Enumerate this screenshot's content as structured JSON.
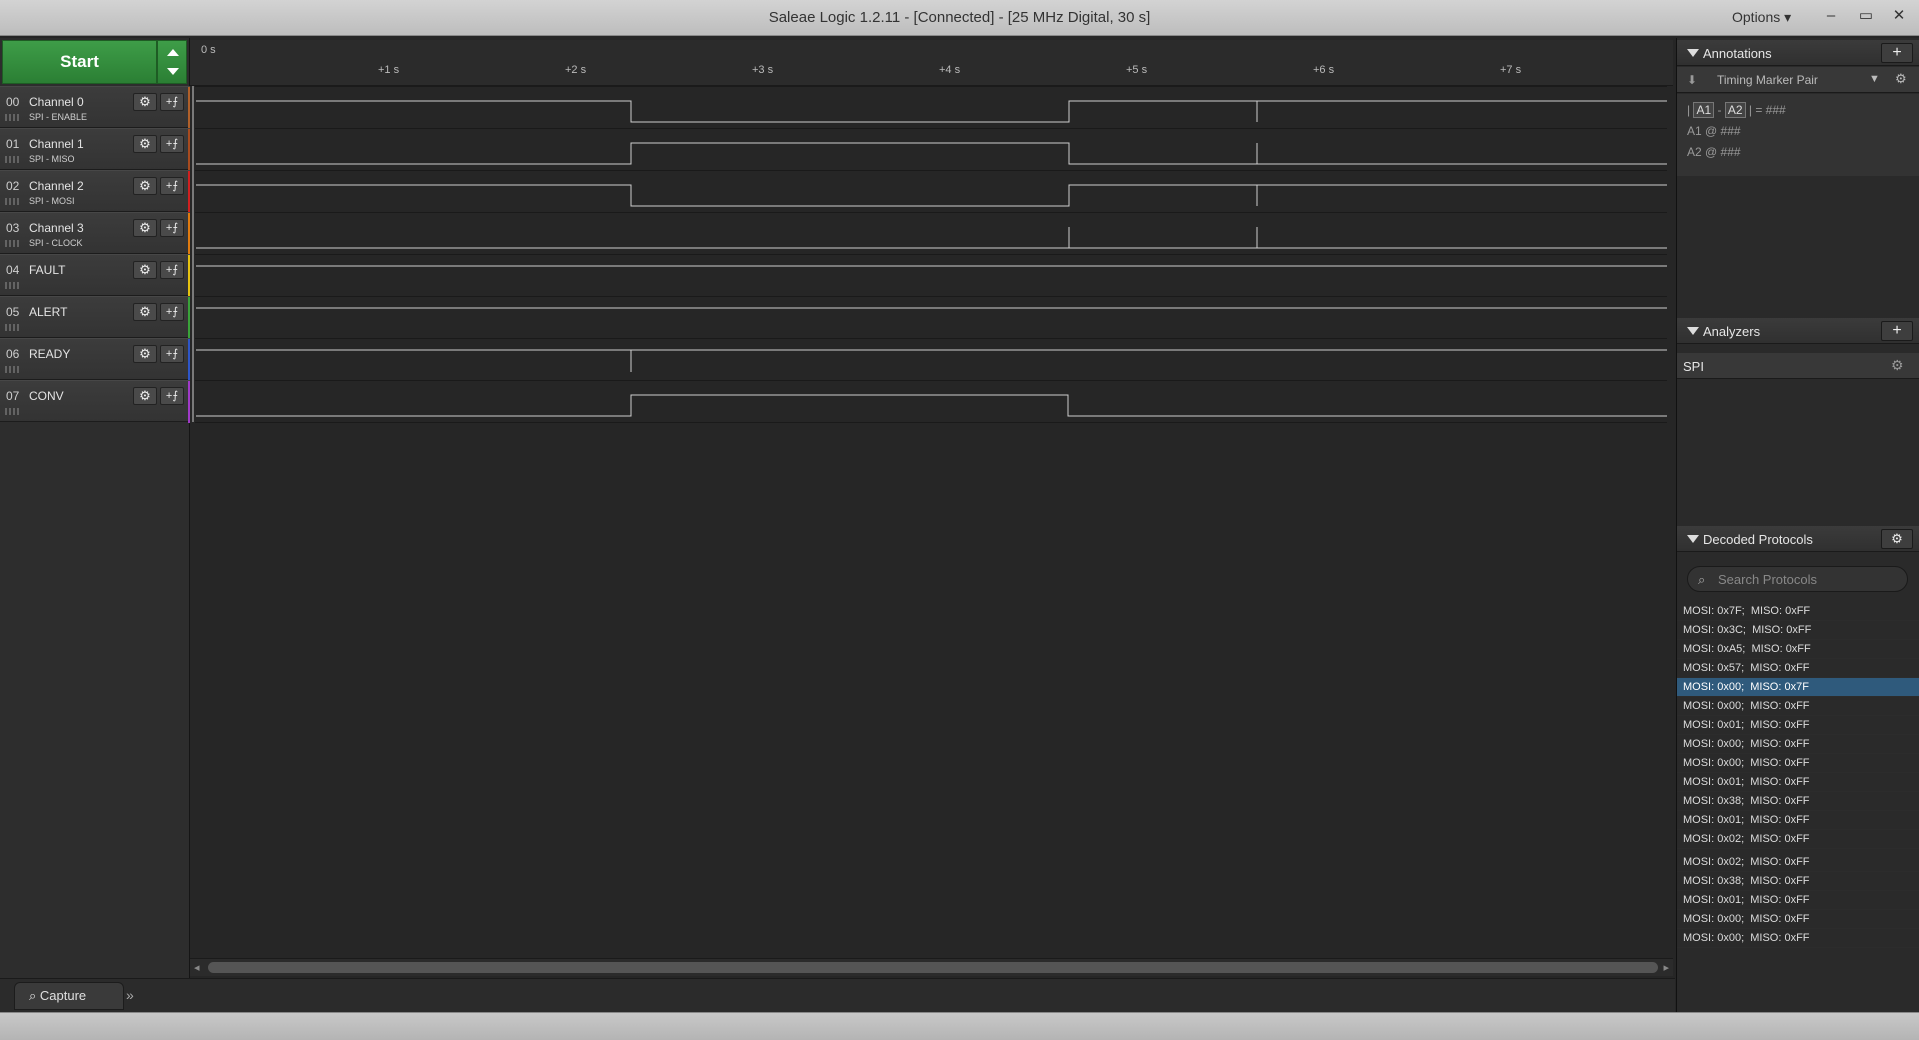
{
  "titlebar": {
    "title": "Saleae Logic 1.2.11 - [Connected] - [25 MHz Digital, 30 s]",
    "options_label": "Options ▾",
    "minimize": "–",
    "maximize": "▭",
    "close": "✕"
  },
  "start_button": "Start",
  "channels": [
    {
      "num": "00",
      "name": "Channel 0",
      "sub": "SPI - ENABLE",
      "color": "#b0602a"
    },
    {
      "num": "01",
      "name": "Channel 1",
      "sub": "SPI - MISO",
      "color": "#a84b1f"
    },
    {
      "num": "02",
      "name": "Channel 2",
      "sub": "SPI - MOSI",
      "color": "#d02020"
    },
    {
      "num": "03",
      "name": "Channel 3",
      "sub": "SPI - CLOCK",
      "color": "#e07b10"
    },
    {
      "num": "04",
      "name": "FAULT",
      "sub": "",
      "color": "#e6c210"
    },
    {
      "num": "05",
      "name": "ALERT",
      "sub": "",
      "color": "#3aa33a"
    },
    {
      "num": "06",
      "name": "READY",
      "sub": "",
      "color": "#2e56c8"
    },
    {
      "num": "07",
      "name": "CONV",
      "sub": "",
      "color": "#a03ac8"
    }
  ],
  "channel_buttons": {
    "gear": "⚙",
    "trigger": "+⨍"
  },
  "ruler": {
    "zero": "0 s",
    "ticks": [
      "+1 s",
      "+2 s",
      "+3 s",
      "+4 s",
      "+5 s",
      "+6 s",
      "+7 s"
    ]
  },
  "bottom": {
    "capture_tab": "Capture",
    "more": "»"
  },
  "annotations": {
    "title": "Annotations",
    "add": "+",
    "marker_pair_label": "Timing Marker Pair",
    "formula_prefix": "|",
    "a1": "A1",
    "minus": "-",
    "a2": "A2",
    "formula_suffix": "| = ###",
    "a1_line": "A1  @  ###",
    "a2_line": "A2  @  ###"
  },
  "analyzers": {
    "title": "Analyzers",
    "add": "+",
    "items": [
      "SPI"
    ]
  },
  "decoded": {
    "title": "Decoded Protocols",
    "search_placeholder": "Search Protocols",
    "rows": [
      "MOSI: 0x7F;  MISO: 0xFF",
      "MOSI: 0x3C;  MISO: 0xFF",
      "MOSI: 0xA5;  MISO: 0xFF",
      "MOSI: 0x57;  MISO: 0xFF",
      "MOSI: 0x00;  MISO: 0x7F",
      "MOSI: 0x00;  MISO: 0xFF",
      "MOSI: 0x01;  MISO: 0xFF",
      "MOSI: 0x00;  MISO: 0xFF",
      "MOSI: 0x00;  MISO: 0xFF",
      "MOSI: 0x01;  MISO: 0xFF",
      "MOSI: 0x38;  MISO: 0xFF",
      "MOSI: 0x01;  MISO: 0xFF",
      "MOSI: 0x02;  MISO: 0xFF",
      "MOSI: 0x02;  MISO: 0xFF",
      "MOSI: 0x38;  MISO: 0xFF",
      "MOSI: 0x01;  MISO: 0xFF",
      "MOSI: 0x00;  MISO: 0xFF",
      "MOSI: 0x00;  MISO: 0xFF"
    ],
    "selected_index": 4
  }
}
